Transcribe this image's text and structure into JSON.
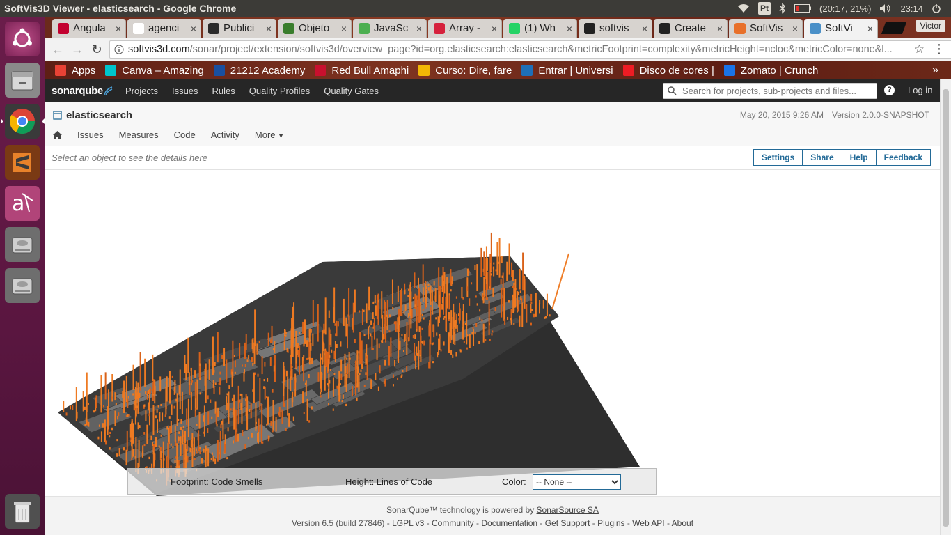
{
  "os": {
    "window_title": "SoftVis3D Viewer - elasticsearch - Google Chrome",
    "keyboard_layout": "Pt",
    "battery": "(20:17, 21%)",
    "clock": "23:14"
  },
  "browser": {
    "profile_name": "Victor",
    "tabs": [
      {
        "label": "Angula",
        "icon_color": "#c3002f",
        "icon": "angular-icon"
      },
      {
        "label": "agenci",
        "icon_color": "#ffffff",
        "icon": "google-icon"
      },
      {
        "label": "Publici",
        "icon_color": "#2b2b2b",
        "icon": "blank-icon"
      },
      {
        "label": "Objeto",
        "icon_color": "#3a7d2c",
        "icon": "gear-icon"
      },
      {
        "label": "JavaSc",
        "icon_color": "#4caf50",
        "icon": "chart-icon"
      },
      {
        "label": "Array -",
        "icon_color": "#d6213c",
        "icon": "codecademy-icon"
      },
      {
        "label": "(1) Wh",
        "icon_color": "#25d366",
        "icon": "whatsapp-icon"
      },
      {
        "label": "softvis",
        "icon_color": "#222222",
        "icon": "github-icon"
      },
      {
        "label": "Create",
        "icon_color": "#222222",
        "icon": "github-icon"
      },
      {
        "label": "SoftVis",
        "icon_color": "#e8702a",
        "icon": "grid-icon"
      },
      {
        "label": "SoftVi",
        "icon_color": "#4a90c8",
        "icon": "sonar-icon",
        "active": true
      }
    ],
    "url_host": "softvis3d.com",
    "url_path": "/sonar/project/extension/softvis3d/overview_page?id=org.elasticsearch:elasticsearch&metricFootprint=complexity&metricHeight=ncloc&metricColor=none&l...",
    "bookmarks": [
      {
        "label": "Apps",
        "icon_color": "#e94235"
      },
      {
        "label": "Canva – Amazing",
        "icon_color": "#00c4cc"
      },
      {
        "label": "21212 Academy",
        "icon_color": "#1a4fa0"
      },
      {
        "label": "Red Bull Amaphi",
        "icon_color": "#c8102e"
      },
      {
        "label": "Curso: Dire, fare",
        "icon_color": "#f2b705"
      },
      {
        "label": "Entrar | Universi",
        "icon_color": "#1e6fb8"
      },
      {
        "label": "Disco de cores |",
        "icon_color": "#ed1c24"
      },
      {
        "label": "Zomato | Crunch",
        "icon_color": "#1a73e8"
      }
    ]
  },
  "sonar": {
    "logo": "sonarqube",
    "nav": [
      "Projects",
      "Issues",
      "Rules",
      "Quality Profiles",
      "Quality Gates"
    ],
    "search_placeholder": "Search for projects, sub-projects and files...",
    "login": "Log in",
    "project_name": "elasticsearch",
    "date": "May 20, 2015 9:26 AM",
    "version": "Version 2.0.0-SNAPSHOT",
    "project_tabs": [
      "Issues",
      "Measures",
      "Code",
      "Activity",
      "More"
    ],
    "details_hint": "Select an object to see the details here",
    "buttons": [
      "Settings",
      "Share",
      "Help",
      "Feedback"
    ],
    "legend": {
      "footprint": "Footprint: Code Smells",
      "height": "Height: Lines of Code",
      "color_label": "Color:",
      "color_value": "-- None --"
    },
    "footer": {
      "line1_prefix": "SonarQube™ technology is powered by ",
      "line1_link": "SonarSource SA",
      "version": "Version 6.5 (build 27846)",
      "links": [
        "LGPL v3",
        "Community",
        "Documentation",
        "Get Support",
        "Plugins",
        "Web API",
        "About"
      ]
    }
  }
}
